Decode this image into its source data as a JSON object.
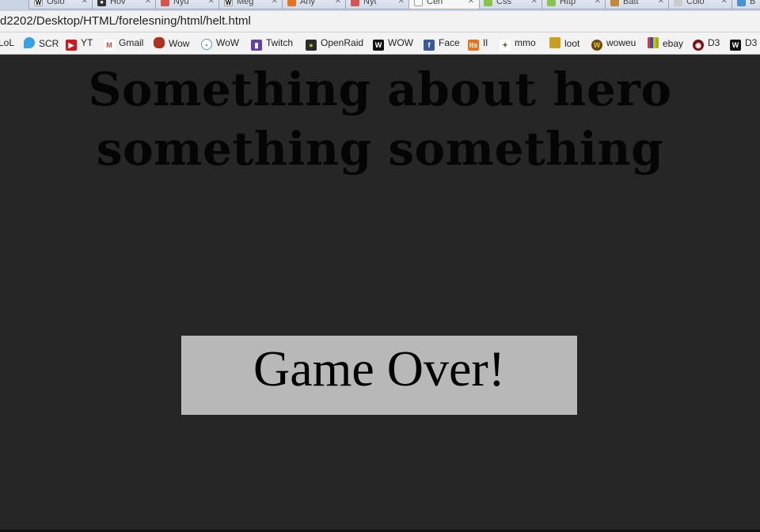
{
  "browser": {
    "tabs": [
      {
        "label": "Oslo",
        "icon": "wikipedia-icon"
      },
      {
        "label": "Hov",
        "icon": "github-icon"
      },
      {
        "label": "Nyu",
        "icon": "bookmark-icon"
      },
      {
        "label": "Meg",
        "icon": "wikipedia-icon"
      },
      {
        "label": "Any",
        "icon": "orange-icon"
      },
      {
        "label": "Nyt",
        "icon": "bookmark-icon"
      },
      {
        "label": "Cen",
        "icon": "page-icon"
      },
      {
        "label": "Css",
        "icon": "green-icon"
      },
      {
        "label": "Http",
        "icon": "green-icon"
      },
      {
        "label": "Batt",
        "icon": "battle-icon"
      },
      {
        "label": "Colo",
        "icon": "page-icon"
      },
      {
        "label": "B",
        "icon": "blue-icon"
      }
    ],
    "url": "d2202/Desktop/HTML/forelesning/html/helt.html",
    "bookmarks": [
      {
        "label": "LoL",
        "icon": "lol-icon",
        "color": "#1a2b4a"
      },
      {
        "label": "SCR",
        "icon": "droplet-icon",
        "color": "#3aa0e0"
      },
      {
        "label": "YT",
        "icon": "youtube-icon",
        "color": "#cc181e"
      },
      {
        "label": "Gmail",
        "icon": "gmail-icon",
        "color": "#d44638"
      },
      {
        "label": "Wow",
        "icon": "shoe-icon",
        "color": "#b03020"
      },
      {
        "label": "WoW",
        "icon": "reddit-icon",
        "color": "#5f99cf"
      },
      {
        "label": "Twitch",
        "icon": "twitch-icon",
        "color": "#6441a5"
      },
      {
        "label": "OpenRaid",
        "icon": "openraid-icon",
        "color": "#2b2b2b"
      },
      {
        "label": "WOW",
        "icon": "w-icon",
        "color": "#111111"
      },
      {
        "label": "Face",
        "icon": "facebook-icon",
        "color": "#3b5998"
      },
      {
        "label": "Il",
        "icon": "its-icon",
        "color": "#e8731c"
      },
      {
        "label": "mmo",
        "icon": "runner-icon",
        "color": "#7a5a3a"
      },
      {
        "label": "loot",
        "icon": "loot-icon",
        "color": "#c8a020"
      },
      {
        "label": "woweu",
        "icon": "wow-logo-icon",
        "color": "#6a4a10"
      },
      {
        "label": "ebay",
        "icon": "ebay-icon",
        "color": "#333333"
      },
      {
        "label": "D3",
        "icon": "diablo-icon",
        "color": "#7a1010"
      },
      {
        "label": "D3",
        "icon": "w-icon",
        "color": "#111111"
      }
    ]
  },
  "page": {
    "title_line1": "Something about hero",
    "title_line2": "something something",
    "game_over": "Game Over!"
  },
  "colors": {
    "background": "#262626",
    "box": "#b8b8b8",
    "text": "#050505"
  }
}
